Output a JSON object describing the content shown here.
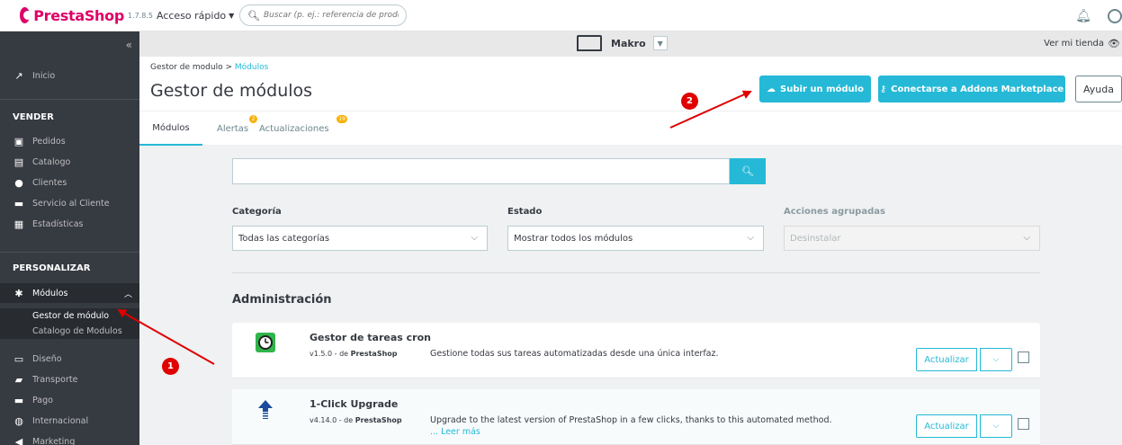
{
  "topbar": {
    "brand": "PrestaShop",
    "version": "1.7.8.5",
    "quick_access": "Acceso rápido",
    "search_placeholder": "Buscar (p. ej.: referencia de producto,"
  },
  "shopbar": {
    "shop_name": "Makro",
    "view_shop": "Ver mi tienda"
  },
  "sidebar": {
    "inicio": "Inicio",
    "sell_heading": "VENDER",
    "sell_items": [
      "Pedidos",
      "Catalogo",
      "Clientes",
      "Servicio al Cliente",
      "Estadísticas"
    ],
    "customize_heading": "PERSONALIZAR",
    "modules": "Módulos",
    "module_subitems": [
      "Gestor de módulo",
      "Catalogo de Modulos"
    ],
    "other_items": [
      "Diseño",
      "Transporte",
      "Pago",
      "Internacional",
      "Marketing"
    ]
  },
  "header": {
    "breadcrumb_parent": "Gestor de modulo",
    "breadcrumb_sep": ">",
    "breadcrumb_current": "Módulos",
    "title": "Gestor de módulos",
    "upload_button": "Subir un módulo",
    "addons_button": "Conectarse a Addons Marketplace",
    "help_button": "Ayuda"
  },
  "tabs": {
    "modules": "Módulos",
    "alerts": "Alertas",
    "alerts_count": "2",
    "updates": "Actualizaciones",
    "updates_count": "19"
  },
  "filters": {
    "category_label": "Categoría",
    "category_value": "Todas las categorías",
    "status_label": "Estado",
    "status_value": "Mostrar todos los módulos",
    "bulk_label": "Acciones agrupadas",
    "bulk_value": "Desinstalar"
  },
  "section": {
    "title": "Administración"
  },
  "modules": [
    {
      "name": "Gestor de tareas cron",
      "version": "v1.5.0 - de",
      "author": "PrestaShop",
      "description": "Gestione todas sus tareas automatizadas desde una única interfaz.",
      "more": "",
      "action": "Actualizar"
    },
    {
      "name": "1-Click Upgrade",
      "version": "v4.14.0 - de",
      "author": "PrestaShop",
      "description": "Upgrade to the latest version of PrestaShop in a few clicks, thanks to this automated method.",
      "more": "... Leer más",
      "action": "Actualizar"
    }
  ],
  "annotations": {
    "marker_1": "1",
    "marker_2": "2"
  },
  "colors": {
    "accent": "#25b9d7",
    "brand": "#df0067",
    "sidebar": "#363a41",
    "annotation": "#e00000"
  }
}
